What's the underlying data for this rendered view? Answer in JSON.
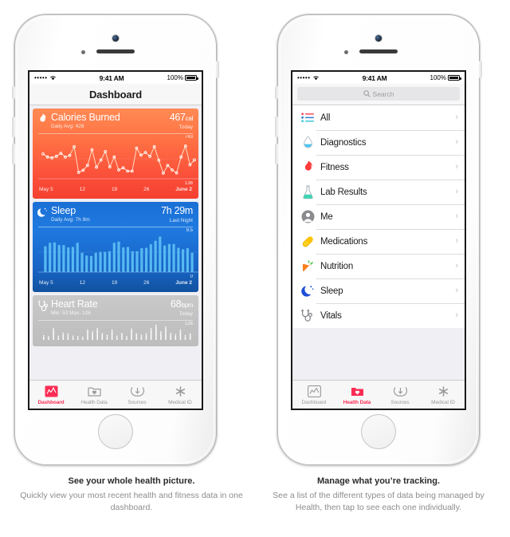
{
  "phones": [
    {
      "id": "dashboard",
      "statusbar": {
        "signal": "•••••",
        "wifi_icon": "wifi-icon",
        "time": "9:41 AM",
        "battery_pct": "100%",
        "battery_icon": "battery-full-icon"
      },
      "navbar": {
        "title": "Dashboard"
      },
      "cards": [
        {
          "key": "calories",
          "icon": "flame-icon",
          "title": "Calories Burned",
          "subtitle": "Daily Avg: 428",
          "value": "467",
          "unit": "cal",
          "when": "Today",
          "y_max": "743",
          "y_min": "136",
          "x_labels": [
            "May 5",
            "12",
            "19",
            "26",
            "June 2"
          ],
          "accent": "#ff7144"
        },
        {
          "key": "sleep",
          "icon": "moon-icon",
          "title": "Sleep",
          "subtitle": "Daily Avg: 7h 9m",
          "value": "7h 29m",
          "unit": "",
          "when": "Last Night",
          "y_max": "9.5",
          "y_min": "0",
          "x_labels": [
            "May 5",
            "12",
            "19",
            "26",
            "June 2"
          ],
          "accent": "#1f7ae0"
        },
        {
          "key": "heart-rate",
          "icon": "stethoscope-icon",
          "title": "Heart Rate",
          "subtitle": "Min: 53 Max: 126",
          "value": "68",
          "unit": "bpm",
          "when": "Today",
          "y_max": "126",
          "y_min": "",
          "x_labels": [],
          "accent": "#c2c2c2"
        }
      ],
      "tabs": [
        {
          "label": "Dashboard",
          "icon": "dashboard-chart-icon",
          "active": true
        },
        {
          "label": "Health Data",
          "icon": "health-data-folder-icon",
          "active": false
        },
        {
          "label": "Sources",
          "icon": "sources-download-icon",
          "active": false
        },
        {
          "label": "Medical ID",
          "icon": "medical-id-asterisk-icon",
          "active": false
        }
      ]
    },
    {
      "id": "health-data",
      "statusbar": {
        "signal": "•••••",
        "wifi_icon": "wifi-icon",
        "time": "9:41 AM",
        "battery_pct": "100%",
        "battery_icon": "battery-full-icon"
      },
      "search": {
        "placeholder": "Search",
        "icon": "search-icon"
      },
      "list": [
        {
          "label": "All",
          "icon": "all-list-icon"
        },
        {
          "label": "Diagnostics",
          "icon": "droplet-icon"
        },
        {
          "label": "Fitness",
          "icon": "flame-icon"
        },
        {
          "label": "Lab Results",
          "icon": "flask-icon"
        },
        {
          "label": "Me",
          "icon": "person-icon"
        },
        {
          "label": "Medications",
          "icon": "pill-icon"
        },
        {
          "label": "Nutrition",
          "icon": "carrot-icon"
        },
        {
          "label": "Sleep",
          "icon": "moon-icon"
        },
        {
          "label": "Vitals",
          "icon": "stethoscope-icon"
        }
      ],
      "chevron": "›",
      "tabs": [
        {
          "label": "Dashboard",
          "icon": "dashboard-chart-icon",
          "active": false
        },
        {
          "label": "Health Data",
          "icon": "health-data-folder-icon",
          "active": true
        },
        {
          "label": "Sources",
          "icon": "sources-download-icon",
          "active": false
        },
        {
          "label": "Medical ID",
          "icon": "medical-id-asterisk-icon",
          "active": false
        }
      ]
    }
  ],
  "captions": [
    {
      "title": "See your whole health picture.",
      "body": "Quickly view your most recent health and fitness data in one dashboard."
    },
    {
      "title": "Manage what you’re tracking.",
      "body": "See a list of the different types of data being managed by Health, then tap to see each one individually."
    }
  ],
  "chart_data": [
    {
      "type": "line",
      "title": "Calories Burned",
      "xlabel": "",
      "ylabel": "cal",
      "ylim": [
        136,
        743
      ],
      "x_tick_labels": [
        "May 5",
        "12",
        "19",
        "26",
        "June 2"
      ],
      "values": [
        520,
        470,
        455,
        480,
        530,
        468,
        495,
        640,
        215,
        250,
        330,
        590,
        300,
        420,
        560,
        305,
        470,
        255,
        290,
        235,
        235,
        615,
        500,
        545,
        480,
        640,
        415,
        200,
        330,
        255,
        205,
        470,
        650,
        340,
        420
      ],
      "grid": true
    },
    {
      "type": "bar",
      "title": "Sleep",
      "xlabel": "",
      "ylabel": "hours",
      "ylim": [
        0,
        9.5
      ],
      "x_tick_labels": [
        "May 5",
        "12",
        "19",
        "26",
        "June 2"
      ],
      "values": [
        6.7,
        7.6,
        7.7,
        7.0,
        7.0,
        6.4,
        6.5,
        7.6,
        5.0,
        4.3,
        4.2,
        5.0,
        5.2,
        5.2,
        5.4,
        7.6,
        7.9,
        6.4,
        6.5,
        5.4,
        5.4,
        6.2,
        6.3,
        7.2,
        8.1,
        9.2,
        6.9,
        7.3,
        7.3,
        6.3,
        5.9,
        6.2,
        5.0
      ],
      "grid": true
    },
    {
      "type": "bar",
      "title": "Heart Rate",
      "xlabel": "",
      "ylabel": "bpm",
      "ylim": [
        53,
        126
      ],
      "x_tick_labels": [],
      "values": [
        62,
        58,
        95,
        60,
        74,
        70,
        60,
        57,
        55,
        88,
        80,
        95,
        72,
        64,
        88,
        60,
        72,
        58,
        92,
        70,
        65,
        70,
        95,
        110,
        80,
        102,
        72,
        66,
        88,
        62,
        70
      ],
      "grid": false
    }
  ]
}
